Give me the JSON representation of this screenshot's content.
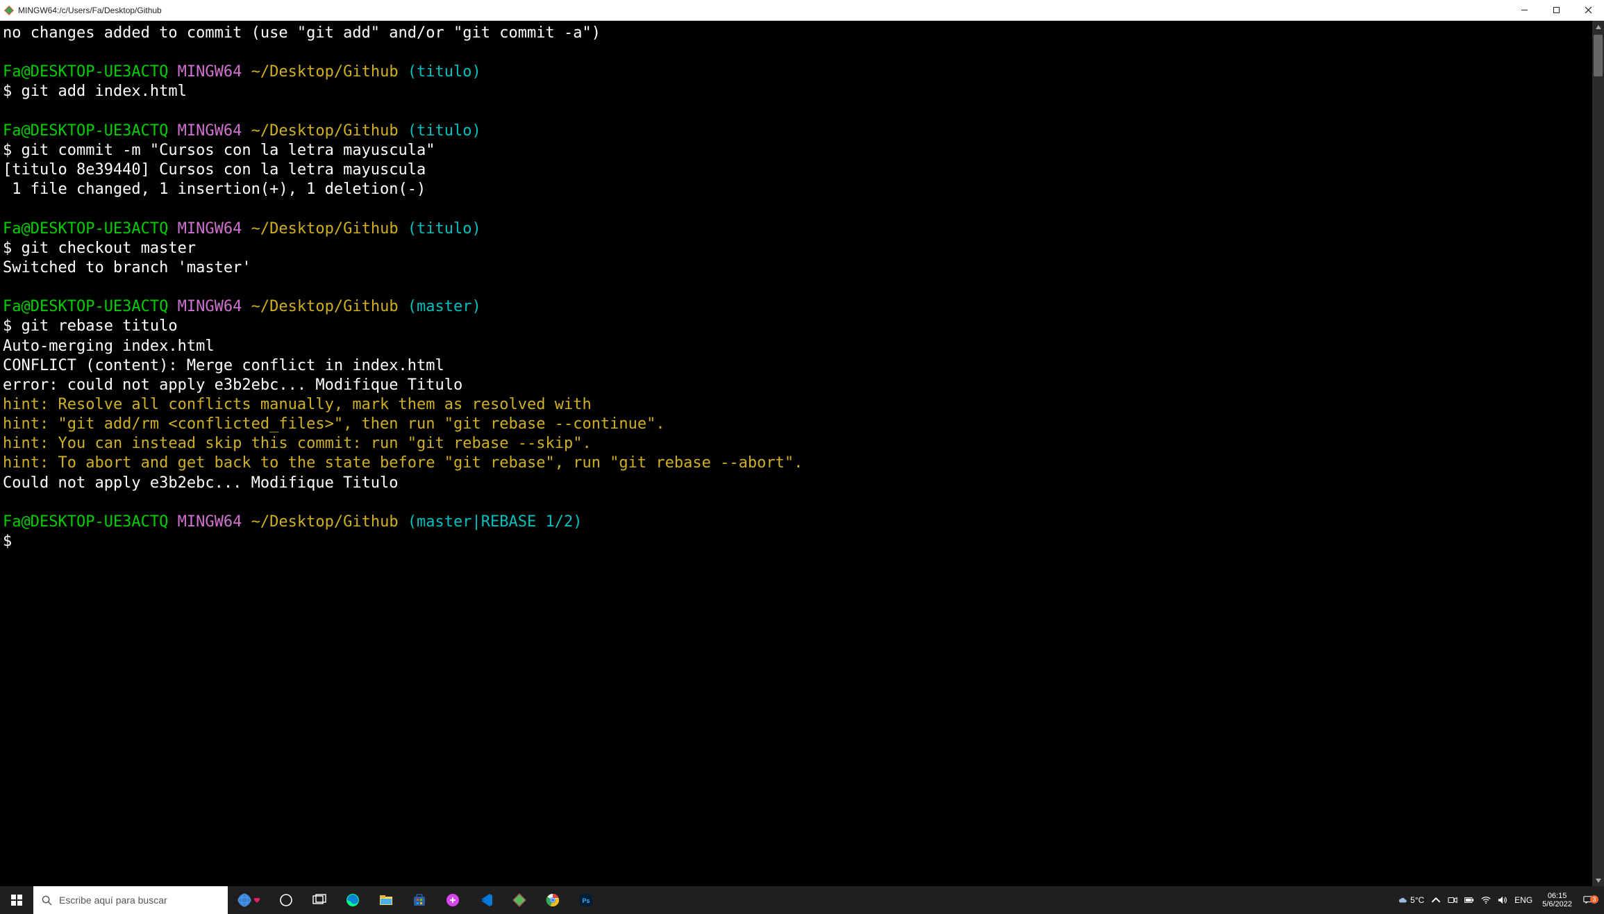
{
  "titlebar": {
    "title": "MINGW64:/c/Users/Fa/Desktop/Github"
  },
  "prompt": {
    "user_host": "Fa@DESKTOP-UE3ACTQ",
    "shell": "MINGW64",
    "path": "~/Desktop/Github",
    "branch_titulo": "(titulo)",
    "branch_master": "(master)",
    "branch_rebase": "(master|REBASE 1/2)",
    "dollar": "$"
  },
  "lines": {
    "l0": "no changes added to commit (use \"git add\" and/or \"git commit -a\")",
    "cmd_add": " git add index.html",
    "cmd_commit": " git commit -m \"Cursos con la letra mayuscula\"",
    "commit_out1": "[titulo 8e39440] Cursos con la letra mayuscula",
    "commit_out2": " 1 file changed, 1 insertion(+), 1 deletion(-)",
    "cmd_checkout": " git checkout master",
    "checkout_out": "Switched to branch 'master'",
    "cmd_rebase": " git rebase titulo",
    "rebase_out1": "Auto-merging index.html",
    "rebase_out2": "CONFLICT (content): Merge conflict in index.html",
    "rebase_out3": "error: could not apply e3b2ebc... Modifique Titulo",
    "hint1": "hint: Resolve all conflicts manually, mark them as resolved with",
    "hint2": "hint: \"git add/rm <conflicted_files>\", then run \"git rebase --continue\".",
    "hint3": "hint: You can instead skip this commit: run \"git rebase --skip\".",
    "hint4": "hint: To abort and get back to the state before \"git rebase\", run \"git rebase --abort\".",
    "rebase_out4": "Could not apply e3b2ebc... Modifique Titulo"
  },
  "taskbar": {
    "search_placeholder": "Escribe aquí para buscar",
    "weather_temp": "5°C",
    "lang": "ENG",
    "time": "06:15",
    "date": "5/6/2022",
    "notif_badge": "3"
  }
}
